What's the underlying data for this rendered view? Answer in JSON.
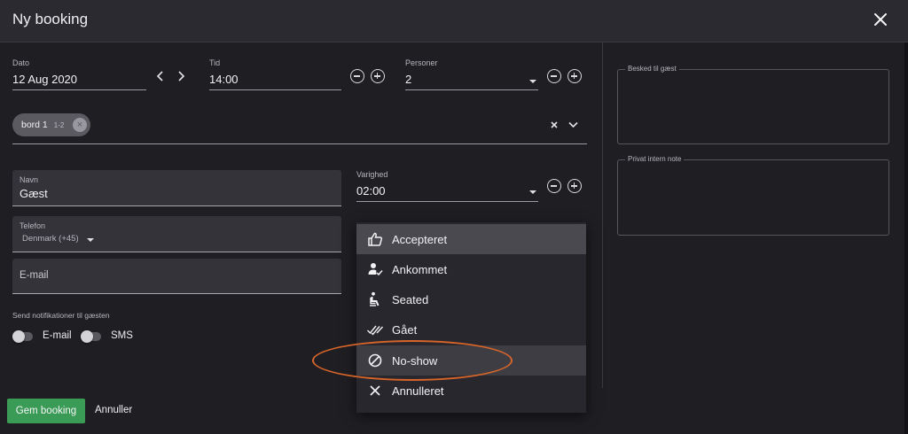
{
  "header": {
    "title": "Ny booking",
    "close_icon": "close-icon"
  },
  "date": {
    "label": "Dato",
    "value": "12 Aug 2020"
  },
  "time": {
    "label": "Tid",
    "value": "14:00"
  },
  "persons": {
    "label": "Personer",
    "value": "2"
  },
  "table_select": {
    "chip_label": "bord 1",
    "chip_capacity": "1-2"
  },
  "name": {
    "label": "Navn",
    "value": "Gæst"
  },
  "duration": {
    "label": "Varighed",
    "value": "02:00"
  },
  "phone": {
    "label": "Telefon",
    "country": "Denmark (+45)"
  },
  "email": {
    "placeholder": "E-mail"
  },
  "notifications": {
    "label": "Send notifikationer til gæsten",
    "email_label": "E-mail",
    "sms_label": "SMS"
  },
  "notes": {
    "guest_message_label": "Besked til gæst",
    "private_note_label": "Privat intern note"
  },
  "status_menu": {
    "items": [
      {
        "label": "Accepteret",
        "icon": "thumbs-up-icon",
        "state": "selected"
      },
      {
        "label": "Ankommet",
        "icon": "person-check-icon",
        "state": "normal"
      },
      {
        "label": "Seated",
        "icon": "seated-person-icon",
        "state": "normal"
      },
      {
        "label": "Gået",
        "icon": "double-check-icon",
        "state": "normal"
      },
      {
        "label": "No-show",
        "icon": "no-entry-icon",
        "state": "hovered"
      },
      {
        "label": "Annulleret",
        "icon": "close-icon",
        "state": "normal"
      }
    ]
  },
  "footer": {
    "save_label": "Gem booking",
    "cancel_label": "Annuller"
  },
  "colors": {
    "primary_button": "#3a9b56",
    "highlight_ring": "#d7652a",
    "background": "#1f1e23"
  }
}
